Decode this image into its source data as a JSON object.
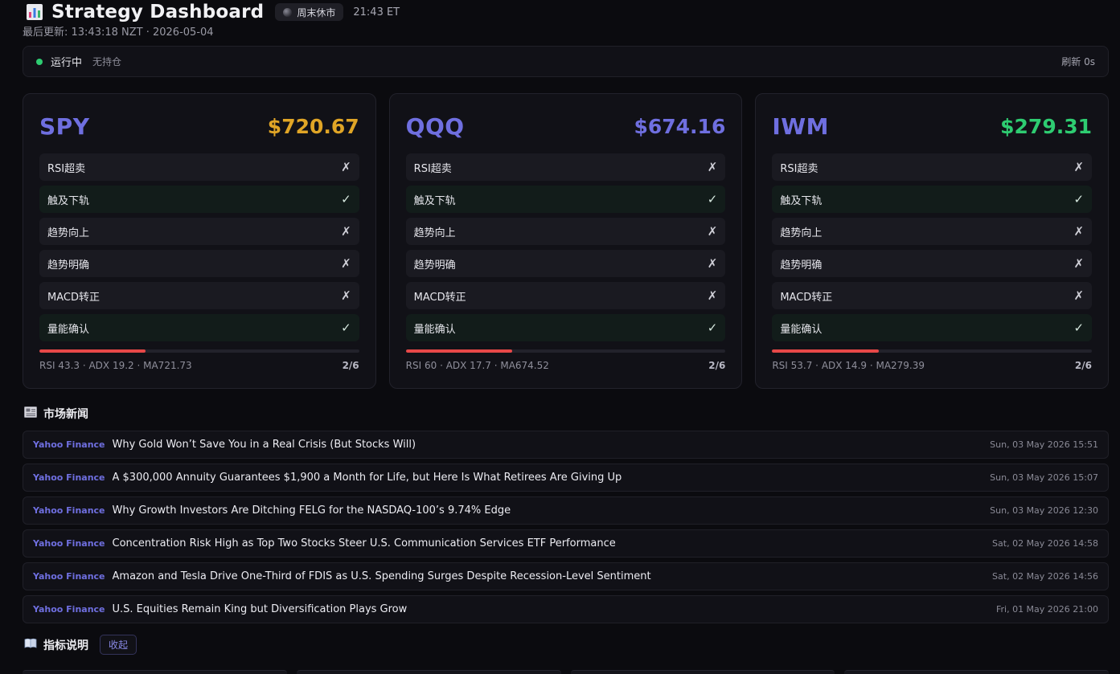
{
  "header": {
    "title": "Strategy Dashboard",
    "market_status": "周末休市",
    "et_time": "21:43 ET",
    "last_updated": "最后更新: 13:43:18 NZT · 2026-05-04"
  },
  "status_bar": {
    "state": "运行中",
    "holding": "无持仓",
    "refresh": "刷新 0s"
  },
  "colors": {
    "accent": "#6f6fe0",
    "spy_price": "#e0a526",
    "qqq_price": "#6f6fe0",
    "iwm_price": "#2ecc71",
    "progress": "#e74848",
    "running": "#2ecc71"
  },
  "cards": [
    {
      "ticker": "SPY",
      "price": "$720.67",
      "conditions": [
        {
          "label": "RSI超卖",
          "mark": "✗",
          "ok": false
        },
        {
          "label": "触及下轨",
          "mark": "✓",
          "ok": true
        },
        {
          "label": "趋势向上",
          "mark": "✗",
          "ok": false
        },
        {
          "label": "趋势明确",
          "mark": "✗",
          "ok": false
        },
        {
          "label": "MACD转正",
          "mark": "✗",
          "ok": false
        },
        {
          "label": "量能确认",
          "mark": "✓",
          "ok": true
        }
      ],
      "progress": 0.333,
      "metrics": "RSI 43.3 · ADX 19.2 · MA721.73",
      "score": "2/6"
    },
    {
      "ticker": "QQQ",
      "price": "$674.16",
      "conditions": [
        {
          "label": "RSI超卖",
          "mark": "✗",
          "ok": false
        },
        {
          "label": "触及下轨",
          "mark": "✓",
          "ok": true
        },
        {
          "label": "趋势向上",
          "mark": "✗",
          "ok": false
        },
        {
          "label": "趋势明确",
          "mark": "✗",
          "ok": false
        },
        {
          "label": "MACD转正",
          "mark": "✗",
          "ok": false
        },
        {
          "label": "量能确认",
          "mark": "✓",
          "ok": true
        }
      ],
      "progress": 0.333,
      "metrics": "RSI 60 · ADX 17.7 · MA674.52",
      "score": "2/6"
    },
    {
      "ticker": "IWM",
      "price": "$279.31",
      "conditions": [
        {
          "label": "RSI超卖",
          "mark": "✗",
          "ok": false
        },
        {
          "label": "触及下轨",
          "mark": "✓",
          "ok": true
        },
        {
          "label": "趋势向上",
          "mark": "✗",
          "ok": false
        },
        {
          "label": "趋势明确",
          "mark": "✗",
          "ok": false
        },
        {
          "label": "MACD转正",
          "mark": "✗",
          "ok": false
        },
        {
          "label": "量能确认",
          "mark": "✓",
          "ok": true
        }
      ],
      "progress": 0.333,
      "metrics": "RSI 53.7 · ADX 14.9 · MA279.39",
      "score": "2/6"
    }
  ],
  "news": {
    "title": "市场新闻",
    "icon": "newspaper-icon",
    "items": [
      {
        "source": "Yahoo Finance",
        "headline": "Why Gold Won’t Save You in a Real Crisis (But Stocks Will)",
        "time": "Sun, 03 May 2026 15:51"
      },
      {
        "source": "Yahoo Finance",
        "headline": "A $300,000 Annuity Guarantees $1,900 a Month for Life, but Here Is What Retirees Are Giving Up",
        "time": "Sun, 03 May 2026 15:07"
      },
      {
        "source": "Yahoo Finance",
        "headline": "Why Growth Investors Are Ditching FELG for the NASDAQ-100’s 9.74% Edge",
        "time": "Sun, 03 May 2026 12:30"
      },
      {
        "source": "Yahoo Finance",
        "headline": "Concentration Risk High as Top Two Stocks Steer U.S. Communication Services ETF Performance",
        "time": "Sat, 02 May 2026 14:58"
      },
      {
        "source": "Yahoo Finance",
        "headline": "Amazon and Tesla Drive One-Third of FDIS as U.S. Spending Surges Despite Recession-Level Sentiment",
        "time": "Sat, 02 May 2026 14:56"
      },
      {
        "source": "Yahoo Finance",
        "headline": "U.S. Equities Remain King but Diversification Plays Grow",
        "time": "Fri, 01 May 2026 21:00"
      }
    ]
  },
  "guide": {
    "title": "指标说明",
    "icon": "book-icon",
    "collapse_label": "收起"
  }
}
